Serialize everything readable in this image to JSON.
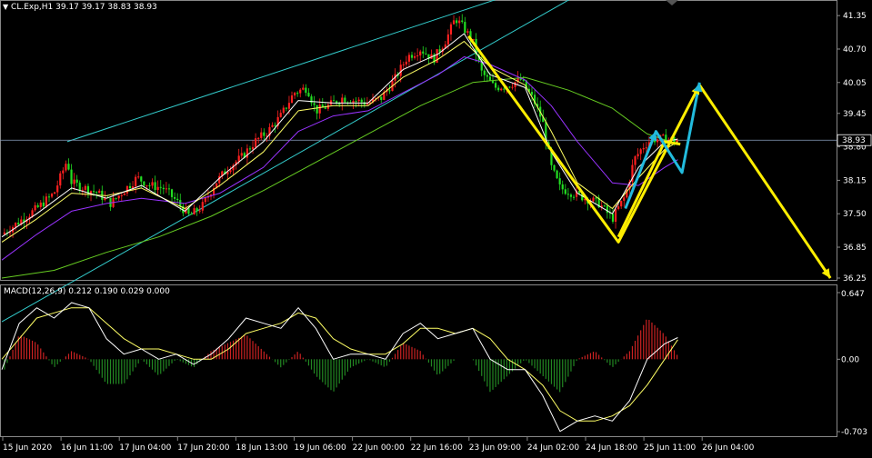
{
  "header": {
    "symbol_line": "CL.Exp,H1  39.17 39.17 38.83 38.93",
    "macd_line": "MACD(12,26,9) 0.212 0.190 0.029 0.000",
    "dropdown_icon": "triangle-down-icon"
  },
  "colors": {
    "background": "#000000",
    "bull_candle": "#ff2020",
    "bear_candle": "#22dd22",
    "channel": "#33cccc",
    "ma_fast": "#ffffff",
    "ma_mid": "#ffff66",
    "ma_slow": "#9933ff",
    "ma_long": "#66cc22",
    "yellow_arrow": "#ffee00",
    "cyan_arrow": "#22bbdd",
    "price_line": "#8aa0c0",
    "macd_main": "#ffffff",
    "macd_signal": "#ffff66",
    "hist_pos": "#cc2222",
    "hist_neg": "#228822"
  },
  "chart_data": [
    {
      "type": "candlestick",
      "instrument": "CL.Exp",
      "timeframe": "H1",
      "ylim": [
        36.25,
        41.6
      ],
      "y_ticks": [
        "41.35",
        "40.70",
        "40.05",
        "39.45",
        "38.80",
        "38.15",
        "37.50",
        "36.85",
        "36.25"
      ],
      "current_price": "38.93",
      "x_ticks": [
        "15 Jun 2020",
        "16 Jun 11:00",
        "17 Jun 04:00",
        "17 Jun 20:00",
        "18 Jun 13:00",
        "19 Jun 06:00",
        "22 Jun 00:00",
        "22 Jun 16:00",
        "23 Jun 09:00",
        "24 Jun 02:00",
        "24 Jun 18:00",
        "25 Jun 11:00",
        "26 Jun 04:00"
      ],
      "price_path": [
        [
          0,
          37.1
        ],
        [
          20,
          37.35
        ],
        [
          40,
          37.6
        ],
        [
          60,
          37.9
        ],
        [
          75,
          38.55
        ],
        [
          80,
          38.1
        ],
        [
          95,
          38.0
        ],
        [
          110,
          37.9
        ],
        [
          125,
          37.7
        ],
        [
          140,
          37.95
        ],
        [
          155,
          38.2
        ],
        [
          170,
          38.05
        ],
        [
          185,
          38.0
        ],
        [
          200,
          37.75
        ],
        [
          215,
          37.45
        ],
        [
          230,
          37.65
        ],
        [
          245,
          38.1
        ],
        [
          260,
          38.4
        ],
        [
          275,
          38.6
        ],
        [
          290,
          38.9
        ],
        [
          305,
          39.1
        ],
        [
          320,
          39.4
        ],
        [
          335,
          39.85
        ],
        [
          350,
          39.95
        ],
        [
          360,
          39.5
        ],
        [
          375,
          39.6
        ],
        [
          390,
          39.75
        ],
        [
          405,
          39.7
        ],
        [
          420,
          39.65
        ],
        [
          435,
          39.75
        ],
        [
          450,
          40.1
        ],
        [
          465,
          40.55
        ],
        [
          480,
          40.7
        ],
        [
          495,
          40.5
        ],
        [
          510,
          40.9
        ],
        [
          520,
          41.3
        ],
        [
          530,
          41.1
        ],
        [
          540,
          40.85
        ],
        [
          550,
          40.25
        ],
        [
          565,
          39.95
        ],
        [
          580,
          40.0
        ],
        [
          595,
          40.1
        ],
        [
          610,
          39.7
        ],
        [
          620,
          39.3
        ],
        [
          630,
          38.4
        ],
        [
          640,
          38.0
        ],
        [
          655,
          37.9
        ],
        [
          670,
          37.8
        ],
        [
          685,
          37.7
        ],
        [
          700,
          37.4
        ],
        [
          715,
          37.85
        ],
        [
          725,
          38.55
        ],
        [
          735,
          38.8
        ],
        [
          745,
          38.95
        ],
        [
          760,
          38.95
        ],
        [
          775,
          38.93
        ]
      ],
      "ma_fast": [
        [
          0,
          37.05
        ],
        [
          40,
          37.5
        ],
        [
          80,
          38.0
        ],
        [
          120,
          37.8
        ],
        [
          160,
          38.05
        ],
        [
          210,
          37.55
        ],
        [
          250,
          38.2
        ],
        [
          300,
          38.9
        ],
        [
          340,
          39.7
        ],
        [
          380,
          39.65
        ],
        [
          420,
          39.65
        ],
        [
          460,
          40.3
        ],
        [
          500,
          40.6
        ],
        [
          530,
          41.0
        ],
        [
          560,
          40.2
        ],
        [
          600,
          39.95
        ],
        [
          630,
          38.7
        ],
        [
          660,
          37.9
        ],
        [
          700,
          37.5
        ],
        [
          730,
          38.4
        ],
        [
          760,
          38.9
        ],
        [
          775,
          38.95
        ]
      ],
      "ma_mid": [
        [
          0,
          36.95
        ],
        [
          40,
          37.4
        ],
        [
          80,
          37.9
        ],
        [
          120,
          37.85
        ],
        [
          160,
          38.0
        ],
        [
          210,
          37.6
        ],
        [
          250,
          38.05
        ],
        [
          300,
          38.7
        ],
        [
          340,
          39.5
        ],
        [
          380,
          39.6
        ],
        [
          420,
          39.6
        ],
        [
          460,
          40.15
        ],
        [
          500,
          40.5
        ],
        [
          530,
          40.85
        ],
        [
          560,
          40.35
        ],
        [
          600,
          40.0
        ],
        [
          630,
          39.1
        ],
        [
          660,
          38.1
        ],
        [
          700,
          37.6
        ],
        [
          730,
          38.2
        ],
        [
          760,
          38.75
        ],
        [
          775,
          38.9
        ]
      ],
      "ma_slow": [
        [
          0,
          36.6
        ],
        [
          40,
          37.1
        ],
        [
          80,
          37.55
        ],
        [
          120,
          37.7
        ],
        [
          160,
          37.8
        ],
        [
          210,
          37.7
        ],
        [
          250,
          37.9
        ],
        [
          300,
          38.4
        ],
        [
          340,
          39.1
        ],
        [
          380,
          39.4
        ],
        [
          420,
          39.5
        ],
        [
          460,
          39.85
        ],
        [
          500,
          40.2
        ],
        [
          530,
          40.55
        ],
        [
          560,
          40.4
        ],
        [
          600,
          40.1
        ],
        [
          630,
          39.6
        ],
        [
          660,
          38.9
        ],
        [
          700,
          38.1
        ],
        [
          730,
          38.05
        ],
        [
          760,
          38.4
        ],
        [
          775,
          38.55
        ]
      ],
      "ma_long": [
        [
          0,
          36.25
        ],
        [
          60,
          36.4
        ],
        [
          120,
          36.75
        ],
        [
          180,
          37.05
        ],
        [
          240,
          37.45
        ],
        [
          300,
          37.95
        ],
        [
          360,
          38.5
        ],
        [
          420,
          39.05
        ],
        [
          480,
          39.6
        ],
        [
          540,
          40.05
        ],
        [
          600,
          40.15
        ],
        [
          650,
          39.9
        ],
        [
          700,
          39.55
        ],
        [
          740,
          39.05
        ],
        [
          775,
          38.85
        ]
      ],
      "channel_upper": [
        [
          75,
          38.9
        ],
        [
          600,
          41.85
        ]
      ],
      "channel_lower": [
        [
          0,
          35.4
        ],
        [
          660,
          41.75
        ]
      ],
      "yellow_path": [
        [
          535,
          40.95
        ],
        [
          707,
          36.95
        ],
        [
          800,
          40.0
        ],
        [
          950,
          36.25
        ]
      ],
      "yellow_short": [
        [
          707,
          37.05
        ],
        [
          760,
          38.9
        ],
        [
          778,
          38.85
        ]
      ],
      "cyan_path": [
        [
          715,
          37.6
        ],
        [
          750,
          39.1
        ],
        [
          780,
          38.3
        ],
        [
          800,
          40.05
        ]
      ]
    },
    {
      "type": "macd",
      "params": "12,26,9",
      "ylim": [
        -0.703,
        0.647
      ],
      "y_ticks": [
        "0.647",
        "0.00",
        "-0.703"
      ],
      "macd_main": [
        [
          0,
          -0.1
        ],
        [
          20,
          0.35
        ],
        [
          40,
          0.5
        ],
        [
          60,
          0.4
        ],
        [
          80,
          0.55
        ],
        [
          100,
          0.5
        ],
        [
          120,
          0.2
        ],
        [
          140,
          0.05
        ],
        [
          160,
          0.1
        ],
        [
          180,
          0.0
        ],
        [
          200,
          0.05
        ],
        [
          220,
          -0.05
        ],
        [
          240,
          0.05
        ],
        [
          260,
          0.2
        ],
        [
          280,
          0.4
        ],
        [
          300,
          0.35
        ],
        [
          320,
          0.3
        ],
        [
          340,
          0.5
        ],
        [
          360,
          0.3
        ],
        [
          380,
          0.0
        ],
        [
          400,
          0.05
        ],
        [
          420,
          0.05
        ],
        [
          440,
          0.0
        ],
        [
          460,
          0.25
        ],
        [
          480,
          0.35
        ],
        [
          500,
          0.2
        ],
        [
          520,
          0.25
        ],
        [
          540,
          0.3
        ],
        [
          560,
          0.0
        ],
        [
          580,
          -0.1
        ],
        [
          600,
          -0.1
        ],
        [
          620,
          -0.35
        ],
        [
          640,
          -0.7
        ],
        [
          660,
          -0.6
        ],
        [
          680,
          -0.55
        ],
        [
          700,
          -0.6
        ],
        [
          720,
          -0.4
        ],
        [
          740,
          0.0
        ],
        [
          760,
          0.15
        ],
        [
          775,
          0.21
        ]
      ],
      "macd_signal": [
        [
          0,
          0.0
        ],
        [
          20,
          0.2
        ],
        [
          40,
          0.4
        ],
        [
          60,
          0.45
        ],
        [
          80,
          0.5
        ],
        [
          100,
          0.5
        ],
        [
          120,
          0.35
        ],
        [
          140,
          0.2
        ],
        [
          160,
          0.1
        ],
        [
          180,
          0.1
        ],
        [
          200,
          0.05
        ],
        [
          220,
          0.0
        ],
        [
          240,
          0.0
        ],
        [
          260,
          0.1
        ],
        [
          280,
          0.25
        ],
        [
          300,
          0.3
        ],
        [
          320,
          0.35
        ],
        [
          340,
          0.45
        ],
        [
          360,
          0.4
        ],
        [
          380,
          0.2
        ],
        [
          400,
          0.1
        ],
        [
          420,
          0.05
        ],
        [
          440,
          0.05
        ],
        [
          460,
          0.15
        ],
        [
          480,
          0.3
        ],
        [
          500,
          0.3
        ],
        [
          520,
          0.25
        ],
        [
          540,
          0.3
        ],
        [
          560,
          0.2
        ],
        [
          580,
          0.0
        ],
        [
          600,
          -0.1
        ],
        [
          620,
          -0.25
        ],
        [
          640,
          -0.5
        ],
        [
          660,
          -0.6
        ],
        [
          680,
          -0.6
        ],
        [
          700,
          -0.55
        ],
        [
          720,
          -0.45
        ],
        [
          740,
          -0.25
        ],
        [
          760,
          0.0
        ],
        [
          775,
          0.19
        ]
      ]
    }
  ]
}
